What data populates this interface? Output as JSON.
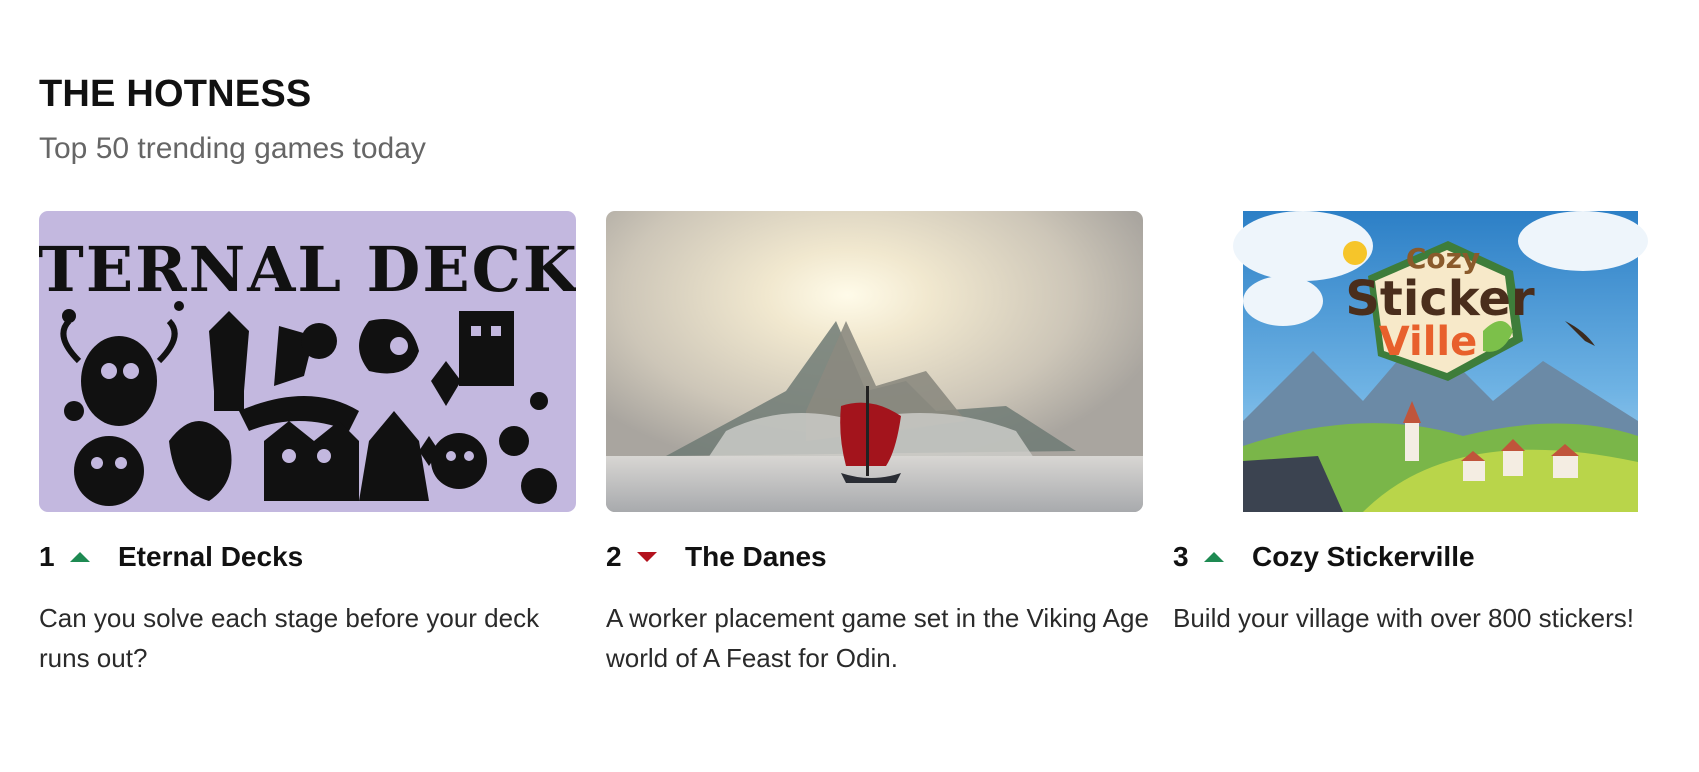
{
  "section": {
    "title": "THE HOTNESS",
    "subtitle": "Top 50 trending games today"
  },
  "colors": {
    "trend_up": "#1e8a52",
    "trend_down": "#b3121d",
    "eternal_bg": "#c3b8df"
  },
  "games": [
    {
      "rank": "1",
      "trend": "up",
      "trend_icon": "triangle-up-icon",
      "title": "Eternal Decks",
      "description": "Can you solve each stage before your deck runs out?",
      "art_text": "ETERNAL DECKS"
    },
    {
      "rank": "2",
      "trend": "down",
      "trend_icon": "triangle-down-icon",
      "title": "The Danes",
      "description": "A worker placement game set in the Viking Age world of A Feast for Odin."
    },
    {
      "rank": "3",
      "trend": "up",
      "trend_icon": "triangle-up-icon",
      "title": "Cozy Stickerville",
      "description": "Build your village with over 800 stickers!",
      "art_text": [
        "Cozy",
        "Sticker",
        "Ville"
      ]
    }
  ]
}
